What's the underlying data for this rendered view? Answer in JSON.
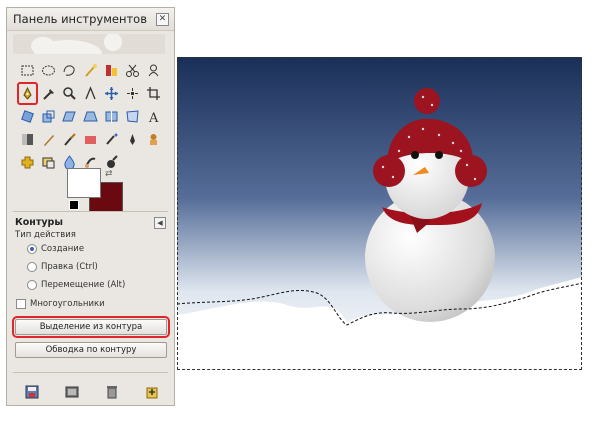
{
  "toolbox": {
    "title": "Панель инструментов",
    "close_icon": "close-icon",
    "tools": [
      {
        "name": "rect-select-icon",
        "color": "#333"
      },
      {
        "name": "ellipse-select-icon",
        "color": "#333"
      },
      {
        "name": "free-select-icon",
        "color": "#333"
      },
      {
        "name": "fuzzy-select-icon",
        "color": "#d0a020"
      },
      {
        "name": "color-select-icon",
        "color": "#c03030"
      },
      {
        "name": "scissors-icon",
        "color": "#333"
      },
      {
        "name": "foreground-select-icon",
        "color": "#333"
      },
      {
        "name": "paths-tool-icon",
        "color": "#d0a020",
        "selected": true
      },
      {
        "name": "color-picker-icon",
        "color": "#333"
      },
      {
        "name": "zoom-icon",
        "color": "#333"
      },
      {
        "name": "measure-icon",
        "color": "#333"
      },
      {
        "name": "move-icon",
        "color": "#2a5ca8"
      },
      {
        "name": "align-icon",
        "color": "#333"
      },
      {
        "name": "crop-icon",
        "color": "#333"
      },
      {
        "name": "rotate-icon",
        "color": "#2a5ca8"
      },
      {
        "name": "scale-icon",
        "color": "#2a5ca8"
      },
      {
        "name": "shear-icon",
        "color": "#2a5ca8"
      },
      {
        "name": "perspective-icon",
        "color": "#2a5ca8"
      },
      {
        "name": "flip-icon",
        "color": "#2a5ca8"
      },
      {
        "name": "cage-icon",
        "color": "#2a5ca8"
      },
      {
        "name": "text-icon",
        "color": "#333"
      },
      {
        "name": "blend-icon",
        "color": "#555"
      },
      {
        "name": "pencil-icon",
        "color": "#b07020"
      },
      {
        "name": "paintbrush-icon",
        "color": "#333"
      },
      {
        "name": "eraser-icon",
        "color": "#e06060"
      },
      {
        "name": "airbrush-icon",
        "color": "#333"
      },
      {
        "name": "ink-icon",
        "color": "#333"
      },
      {
        "name": "clone-icon",
        "color": "#c08020"
      },
      {
        "name": "heal-icon",
        "color": "#e0b020"
      },
      {
        "name": "perspective-clone-icon",
        "color": "#333"
      },
      {
        "name": "blur-icon",
        "color": "#2a5ca8"
      },
      {
        "name": "smudge-icon",
        "color": "#333"
      },
      {
        "name": "dodge-burn-icon",
        "color": "#333"
      }
    ],
    "colors": {
      "foreground": "#ffffff",
      "background": "#6a0a10"
    },
    "options": {
      "title": "Контуры",
      "edit_mode_label": "Тип действия",
      "modes": [
        {
          "label": "Создание",
          "checked": true
        },
        {
          "label": "Правка (Ctrl)",
          "checked": false
        },
        {
          "label": "Перемещение (Alt)",
          "checked": false
        }
      ],
      "polygonal_label": "Многоугольники",
      "polygonal_checked": false,
      "selection_button": "Выделение из контура",
      "stroke_button": "Обводка по контуру"
    },
    "bottom_icons": [
      "save-icon",
      "restore-icon",
      "delete-icon",
      "reset-icon"
    ]
  },
  "canvas": {
    "sky_top": "#1a2f58",
    "sky_bottom": "#ffffff",
    "hat_color": "#9c1420",
    "scarf_color": "#a3121c",
    "nose_color": "#f08a1c"
  }
}
